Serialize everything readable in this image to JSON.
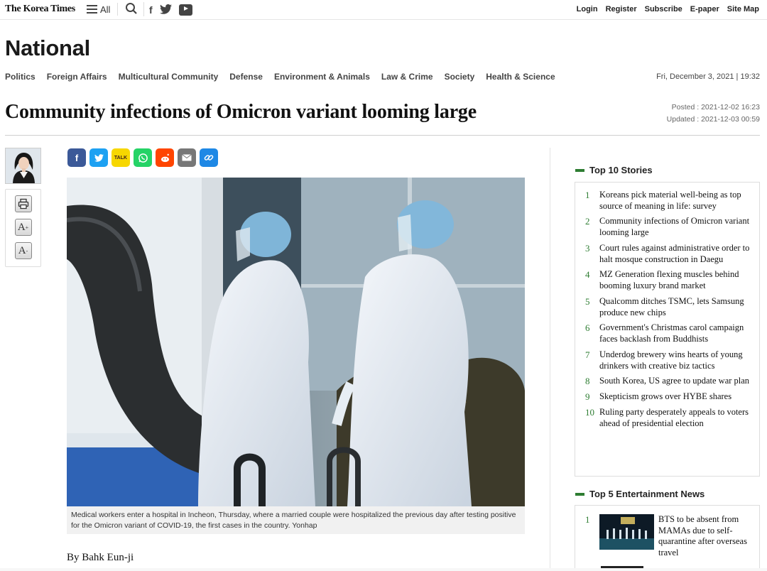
{
  "header": {
    "logo": "The Korea Times",
    "menu_label": "All",
    "links": [
      "Login",
      "Register",
      "Subscribe",
      "E-paper",
      "Site Map"
    ]
  },
  "section": {
    "title": "National",
    "nav": [
      "Politics",
      "Foreign Affairs",
      "Multicultural Community",
      "Defense",
      "Environment & Animals",
      "Law & Crime",
      "Society",
      "Health & Science"
    ],
    "date": "Fri, December 3, 2021 | 19:32"
  },
  "article": {
    "headline": "Community infections of Omicron variant looming large",
    "posted": "Posted : 2021-12-02 16:23",
    "updated": "Updated : 2021-12-03 00:59",
    "caption": "Medical workers enter a hospital in Incheon, Thursday, where a married couple were hospitalized the previous day after testing positive for the Omicron variant of COVID-19, the first cases in the country. Yonhap",
    "byline": "By Bahk Eun-ji"
  },
  "tools": [
    "print-icon",
    "font-increase-icon",
    "font-decrease-icon"
  ],
  "share_buttons": [
    {
      "name": "facebook-share-button",
      "glyph": "f",
      "color": "#3b5998"
    },
    {
      "name": "twitter-share-button",
      "glyph": "t",
      "color": "#1da1f2"
    },
    {
      "name": "kakaotalk-share-button",
      "glyph": "TALK",
      "color": "#f7d700"
    },
    {
      "name": "whatsapp-share-button",
      "glyph": "w",
      "color": "#25d366"
    },
    {
      "name": "reddit-share-button",
      "glyph": "r",
      "color": "#ff4500"
    },
    {
      "name": "email-share-button",
      "glyph": "✉",
      "color": "#777777"
    },
    {
      "name": "copy-link-button",
      "glyph": "⚭",
      "color": "#1e88e5"
    }
  ],
  "sidebar": {
    "top10_title": "Top 10 Stories",
    "top10": [
      "Koreans pick material well-being as top source of meaning in life: survey",
      "Community infections of Omicron variant looming large",
      "Court rules against administrative order to halt mosque construction in Daegu",
      "MZ Generation flexing muscles behind booming luxury brand market",
      "Qualcomm ditches TSMC, lets Samsung produce new chips",
      "Government's Christmas carol campaign faces backlash from Buddhists",
      "Underdog brewery wins hearts of young drinkers with creative biz tactics",
      "South Korea, US agree to update war plan",
      "Skepticism grows over HYBE shares",
      "Ruling party desperately appeals to voters ahead of presidential election"
    ],
    "ent_title": "Top 5 Entertainment News",
    "ent": [
      "BTS to be absent from MAMAs due to self-quarantine after overseas travel"
    ]
  },
  "colors": {
    "accent_green": "#2e7d32"
  }
}
